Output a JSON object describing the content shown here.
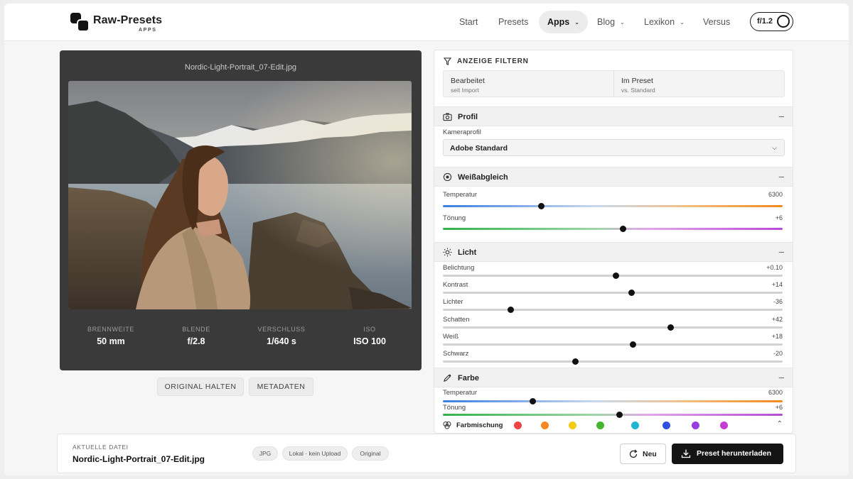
{
  "brand": {
    "name": "Raw-Presets",
    "sub": "APPS"
  },
  "nav": {
    "items": [
      {
        "label": "Start"
      },
      {
        "label": "Presets"
      },
      {
        "label": "Apps",
        "active": true
      },
      {
        "label": "Blog"
      },
      {
        "label": "Lexikon"
      },
      {
        "label": "Versus"
      }
    ],
    "aperture_label": "f/1.2"
  },
  "photo": {
    "filename": "Nordic-Light-Portrait_07-Edit.jpg",
    "exif": [
      {
        "label": "BRENNWEITE",
        "value": "50 mm"
      },
      {
        "label": "BLENDE",
        "value": "f/2.8"
      },
      {
        "label": "VERSCHLUSS",
        "value": "1/640 s"
      },
      {
        "label": "ISO",
        "value": "ISO 100"
      }
    ],
    "buttons": {
      "original": "ORIGINAL HALTEN",
      "metadata": "METADATEN"
    }
  },
  "panel": {
    "filter_title": "ANZEIGE FILTERN",
    "filters": [
      {
        "title": "Bearbeitet",
        "sub": "seit Import"
      },
      {
        "title": "Im Preset",
        "sub": "vs. Standard"
      }
    ],
    "profil": {
      "title": "Profil",
      "camera_label": "Kameraprofil",
      "camera_value": "Adobe Standard"
    },
    "weissabgleich": {
      "title": "Weißabgleich",
      "sliders": [
        {
          "label": "Temperatur",
          "value": "6300",
          "pos": 0.29
        },
        {
          "label": "Tönung",
          "value": "+6",
          "pos": 0.53
        }
      ]
    },
    "licht": {
      "title": "Licht",
      "sliders": [
        {
          "label": "Belichtung",
          "value": "+0.10",
          "pos": 0.51
        },
        {
          "label": "Kontrast",
          "value": "+14",
          "pos": 0.555
        },
        {
          "label": "Lichter",
          "value": "-36",
          "pos": 0.2
        },
        {
          "label": "Schatten",
          "value": "+42",
          "pos": 0.67
        },
        {
          "label": "Weiß",
          "value": "+18",
          "pos": 0.56
        },
        {
          "label": "Schwarz",
          "value": "-20",
          "pos": 0.39
        }
      ]
    },
    "farbe": {
      "title": "Farbe",
      "sliders": [
        {
          "label": "Temperatur",
          "value": "6300",
          "pos": 0.265
        },
        {
          "label": "Tönung",
          "value": "+6",
          "pos": 0.52
        }
      ],
      "mix_label": "Farbmischung",
      "mix_colors": [
        "#ef4444",
        "#f7881f",
        "#f2cb14",
        "#43b52e",
        "#1fb6d4",
        "#2f4fe0",
        "#9a3de0",
        "#c43dd1"
      ]
    }
  },
  "footer": {
    "label": "AKTUELLE DATEI",
    "filename": "Nordic-Light-Portrait_07-Edit.jpg",
    "tags": [
      "JPG",
      "Lokal · kein Upload",
      "Original"
    ],
    "new_label": "Neu",
    "download_label": "Preset herunterladen"
  }
}
